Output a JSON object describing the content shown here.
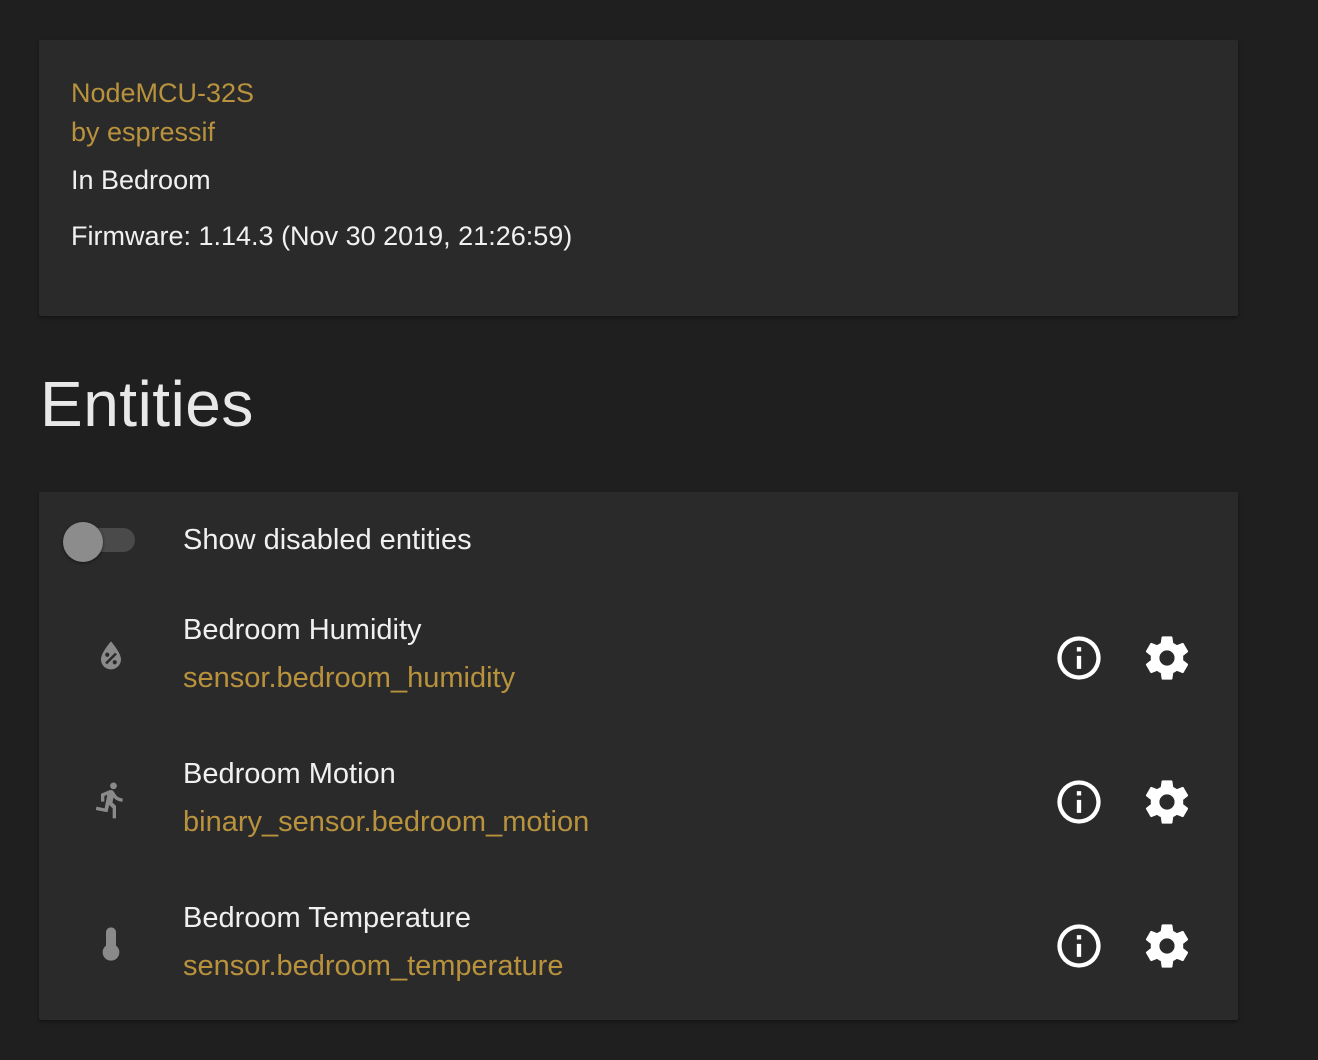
{
  "device": {
    "model": "NodeMCU-32S",
    "manufacturer": "by espressif",
    "area": "In Bedroom",
    "firmware": "Firmware: 1.14.3 (Nov 30 2019, 21:26:59)"
  },
  "entities_section": {
    "title": "Entities",
    "show_disabled": {
      "label": "Show disabled entities",
      "checked": false
    },
    "items": [
      {
        "name": "Bedroom Humidity",
        "entity_id": "sensor.bedroom_humidity",
        "icon": "water-percent-icon"
      },
      {
        "name": "Bedroom Motion",
        "entity_id": "binary_sensor.bedroom_motion",
        "icon": "run-icon"
      },
      {
        "name": "Bedroom Temperature",
        "entity_id": "sensor.bedroom_temperature",
        "icon": "thermometer-icon"
      }
    ],
    "row_actions": {
      "info_icon": "information-outline-icon",
      "settings_icon": "gear-icon"
    }
  },
  "colors": {
    "background": "#1f1f1f",
    "card": "#2a2a2a",
    "accent": "#b8923c",
    "primary_text": "#f0f0f0",
    "secondary_icon": "#8a8a8a"
  }
}
